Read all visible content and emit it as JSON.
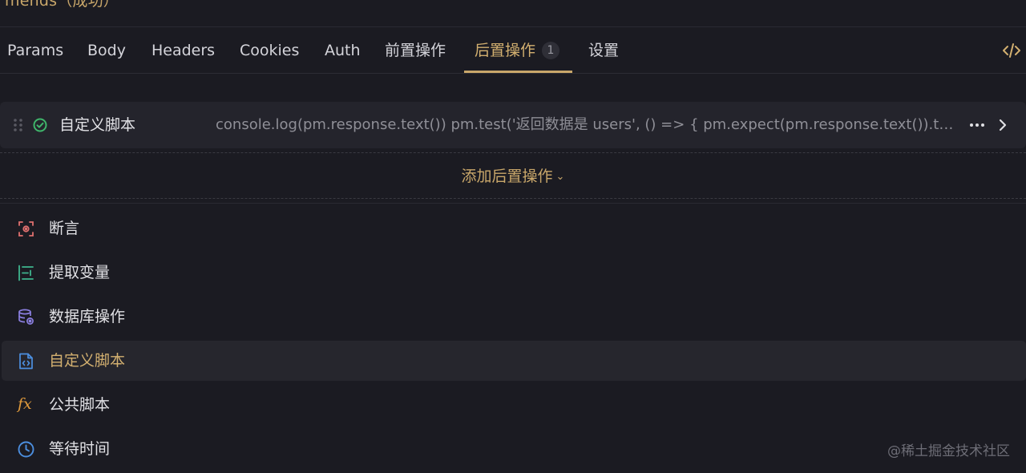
{
  "header": {
    "title": "mends（成功）"
  },
  "tabs": [
    {
      "label": "Params"
    },
    {
      "label": "Body"
    },
    {
      "label": "Headers"
    },
    {
      "label": "Cookies"
    },
    {
      "label": "Auth"
    },
    {
      "label": "前置操作"
    },
    {
      "label": "后置操作",
      "badge": "1",
      "active": true
    },
    {
      "label": "设置"
    }
  ],
  "script_row": {
    "name": "自定义脚本",
    "preview": "console.log(pm.response.text()) pm.test('返回数据是 users', () => { pm.expect(pm.response.text()).to.include('users') })"
  },
  "add_action": {
    "label": "添加后置操作"
  },
  "menu": [
    {
      "label": "断言",
      "icon": "assertion-icon"
    },
    {
      "label": "提取变量",
      "icon": "extract-variable-icon"
    },
    {
      "label": "数据库操作",
      "icon": "database-icon"
    },
    {
      "label": "自定义脚本",
      "icon": "script-file-icon",
      "highlighted": true
    },
    {
      "label": "公共脚本",
      "icon": "fx-icon"
    },
    {
      "label": "等待时间",
      "icon": "clock-icon"
    }
  ],
  "watermark": "@稀土掘金技术社区",
  "colors": {
    "accent": "#c9a76a",
    "background": "#1b1b22",
    "row_background": "#24242c",
    "success": "#3fb56b"
  }
}
